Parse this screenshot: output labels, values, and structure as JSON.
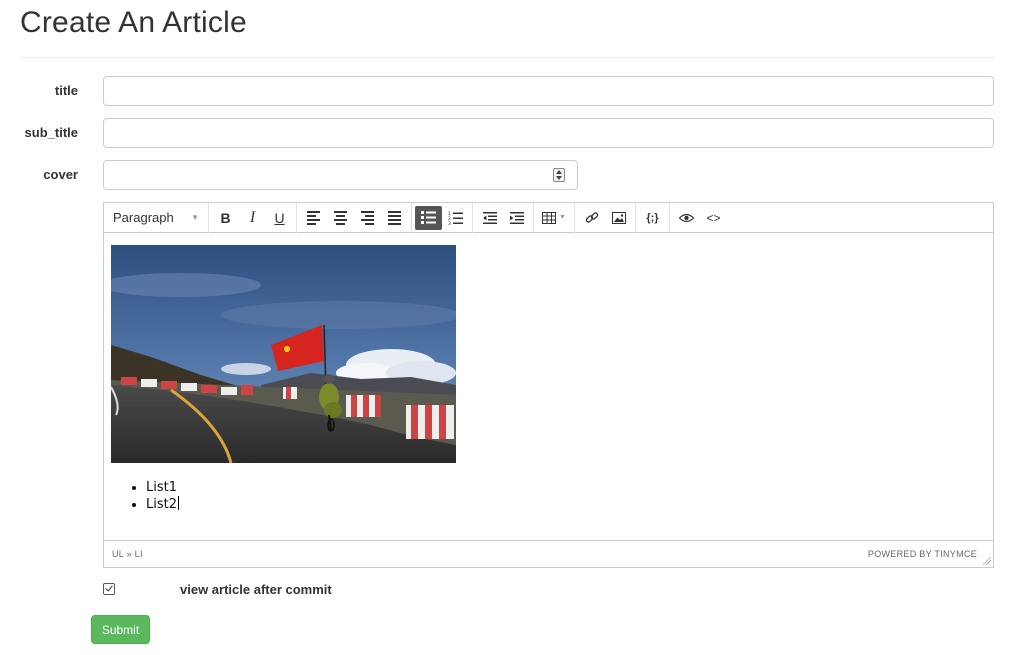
{
  "page": {
    "title": "Create An Article"
  },
  "form": {
    "title_label": "title",
    "title_value": "",
    "subtitle_label": "sub_title",
    "subtitle_value": "",
    "cover_label": "cover",
    "cover_value": ""
  },
  "editor": {
    "toolbar": {
      "format_select": "Paragraph",
      "bold": "B",
      "italic": "I",
      "underline": "U",
      "codesample": "{;}",
      "source": "<>"
    },
    "content": {
      "image_alt": "Cyclist riding a mountain road carrying a red flag",
      "list_items": [
        "List1",
        "List2"
      ]
    },
    "statusbar": {
      "path": "UL » LI",
      "powered_by": "POWERED BY TINYMCE"
    }
  },
  "options": {
    "view_after_commit_label": "view article after commit",
    "view_after_commit_checked": true
  },
  "actions": {
    "submit_label": "Submit"
  },
  "colors": {
    "submit": "#5cb85c",
    "active_button": "#555555"
  }
}
